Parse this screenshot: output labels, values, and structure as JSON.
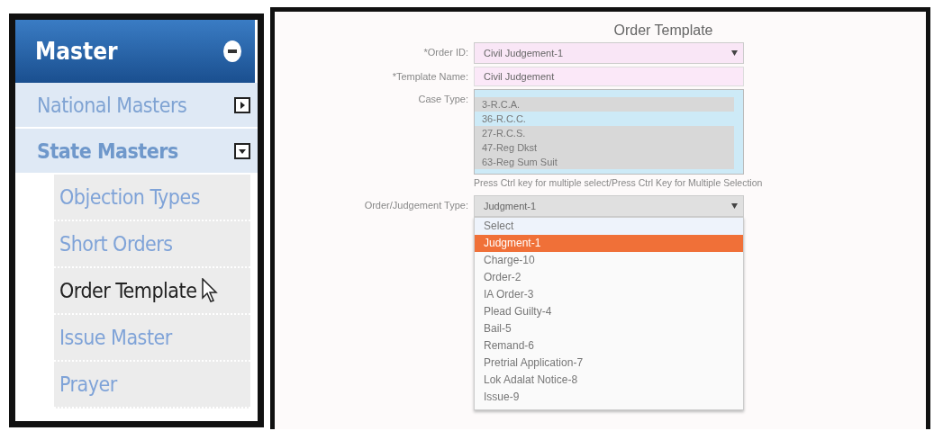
{
  "sidebar": {
    "title": "Master",
    "expanded": true,
    "items": [
      {
        "label": "National Masters",
        "expanded": false,
        "selected": false
      },
      {
        "label": "State Masters",
        "expanded": true,
        "selected": false,
        "children": [
          {
            "label": "Objection Types",
            "selected": false
          },
          {
            "label": "Short Orders",
            "selected": false
          },
          {
            "label": "Order Template",
            "selected": true
          },
          {
            "label": "Issue Master",
            "selected": false
          },
          {
            "label": "Prayer",
            "selected": false
          }
        ]
      }
    ]
  },
  "form": {
    "title": "Order Template",
    "order_id": {
      "label": "*Order ID:",
      "value": "Civil Judgement-1"
    },
    "template_name": {
      "label": "*Template Name:",
      "value": "Civil Judgement"
    },
    "case_type": {
      "label": "Case Type:",
      "options": [
        {
          "label": "3-R.C.A.",
          "selected": true
        },
        {
          "label": "36-R.C.C.",
          "selected": false
        },
        {
          "label": "27-R.C.S.",
          "selected": true
        },
        {
          "label": "47-Reg Dkst",
          "selected": true
        },
        {
          "label": "63-Reg Sum Suit",
          "selected": true
        }
      ],
      "hint": "Press Ctrl key for multiple select/Press Ctrl Key for Multiple Selection"
    },
    "judgement_type": {
      "label": "Order/Judgement Type:",
      "value": "Judgment-1",
      "expanded": true,
      "options": [
        {
          "label": "Select",
          "selected": false
        },
        {
          "label": "Judgment-1",
          "selected": true
        },
        {
          "label": "Charge-10",
          "selected": false
        },
        {
          "label": "Order-2",
          "selected": false
        },
        {
          "label": "IA Order-3",
          "selected": false
        },
        {
          "label": "Plead Guilty-4",
          "selected": false
        },
        {
          "label": "Bail-5",
          "selected": false
        },
        {
          "label": "Remand-6",
          "selected": false
        },
        {
          "label": "Pretrial Application-7",
          "selected": false
        },
        {
          "label": "Lok Adalat Notice-8",
          "selected": false
        },
        {
          "label": "Issue-9",
          "selected": false
        }
      ]
    }
  }
}
